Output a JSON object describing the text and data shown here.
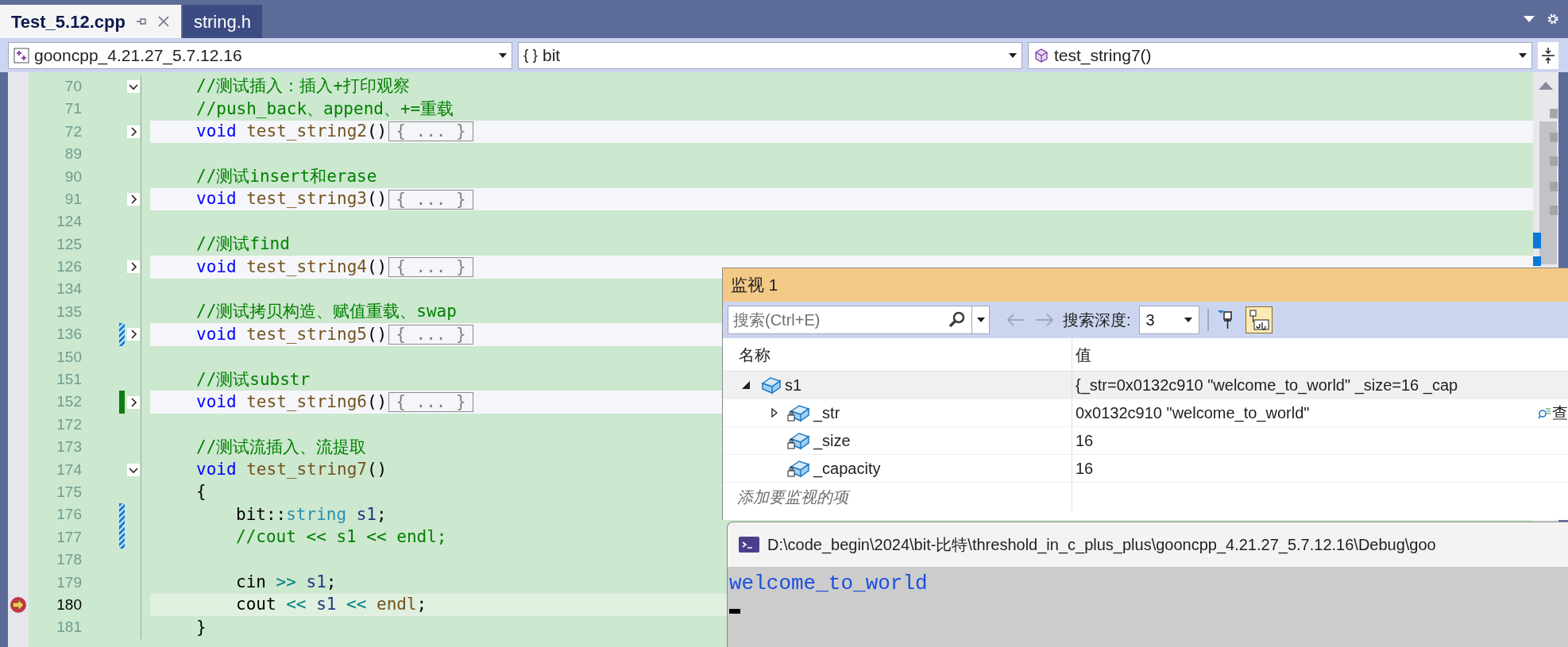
{
  "tabs": [
    {
      "label": "Test_5.12.cpp",
      "selected": true
    },
    {
      "label": "string.h",
      "selected": false
    }
  ],
  "navigation": [
    {
      "kind": "project",
      "text": "gooncpp_4.21.27_5.7.12.16"
    },
    {
      "kind": "scope",
      "glyph": "{ }",
      "text": "bit"
    },
    {
      "kind": "function",
      "text": "test_string7()"
    }
  ],
  "code": [
    {
      "number": "70",
      "collapsed": false,
      "current": false,
      "tokens": [
        {
          "kind": "comment",
          "text": "//测试插入：插入+打印观察"
        }
      ]
    },
    {
      "number": "71",
      "current": false,
      "tokens": [
        {
          "kind": "comment",
          "text": "//push_back、append、+=重载"
        }
      ]
    },
    {
      "number": "72",
      "collapsed": true,
      "collapsed_body": "{ ... }",
      "current": false,
      "tokens": [
        {
          "kind": "keyword",
          "text": "void"
        },
        {
          "kind": "function",
          "text": " test_string2"
        },
        {
          "kind": "punct",
          "text": "()"
        }
      ]
    },
    {
      "number": "89",
      "current": false
    },
    {
      "number": "90",
      "current": false,
      "tokens": [
        {
          "kind": "comment",
          "text": "//测试insert和erase"
        }
      ]
    },
    {
      "number": "91",
      "collapsed": true,
      "collapsed_body": "{ ... }",
      "current": false,
      "tokens": [
        {
          "kind": "keyword",
          "text": "void"
        },
        {
          "kind": "function",
          "text": " test_string3"
        },
        {
          "kind": "punct",
          "text": "()"
        }
      ]
    },
    {
      "number": "124",
      "current": false
    },
    {
      "number": "125",
      "current": false,
      "tokens": [
        {
          "kind": "comment",
          "text": "//测试find"
        }
      ]
    },
    {
      "number": "126",
      "collapsed": true,
      "collapsed_body": "{ ... }",
      "current": false,
      "tokens": [
        {
          "kind": "keyword",
          "text": "void"
        },
        {
          "kind": "function",
          "text": " test_string4"
        },
        {
          "kind": "punct",
          "text": "()"
        }
      ]
    },
    {
      "number": "134",
      "current": false
    },
    {
      "number": "135",
      "current": false,
      "tokens": [
        {
          "kind": "comment",
          "text": "//测试拷贝构造、赋值重载、swap"
        }
      ]
    },
    {
      "number": "136",
      "collapsed": true,
      "collapsed_body": "{ ... }",
      "change_saved": false,
      "current": false,
      "tokens": [
        {
          "kind": "keyword",
          "text": "void"
        },
        {
          "kind": "function",
          "text": " test_string5"
        },
        {
          "kind": "punct",
          "text": "()"
        }
      ]
    },
    {
      "number": "150",
      "current": false
    },
    {
      "number": "151",
      "current": false,
      "tokens": [
        {
          "kind": "comment",
          "text": "//测试substr"
        }
      ]
    },
    {
      "number": "152",
      "collapsed": true,
      "collapsed_body": "{ ... }",
      "change_saved": true,
      "current": false,
      "tokens": [
        {
          "kind": "keyword",
          "text": "void"
        },
        {
          "kind": "function",
          "text": " test_string6"
        },
        {
          "kind": "punct",
          "text": "()"
        }
      ]
    },
    {
      "number": "172",
      "current": false
    },
    {
      "number": "173",
      "current": false,
      "tokens": [
        {
          "kind": "comment",
          "text": "//测试流插入、流提取"
        }
      ]
    },
    {
      "number": "174",
      "collapsed": false,
      "current": false,
      "tokens": [
        {
          "kind": "keyword",
          "text": "void"
        },
        {
          "kind": "function",
          "text": " test_string7"
        },
        {
          "kind": "punct",
          "text": "()"
        }
      ]
    },
    {
      "number": "175",
      "current": false,
      "tokens": [
        {
          "kind": "punct",
          "text": "{"
        }
      ],
      "children": [
        {
          "number": "176",
          "change_saved": false,
          "current": false,
          "tokens": [
            {
              "kind": "punct",
              "text": "bit::"
            },
            {
              "kind": "type",
              "text": "string"
            },
            {
              "kind": "variable",
              "text": " s1"
            },
            {
              "kind": "punct",
              "text": ";"
            }
          ]
        },
        {
          "number": "177",
          "change_saved": false,
          "current": false,
          "tokens": [
            {
              "kind": "comment",
              "text": "//cout << s1 << endl;"
            }
          ]
        },
        {
          "number": "178",
          "current": false
        },
        {
          "number": "179",
          "current": false,
          "tokens": [
            {
              "kind": "punct",
              "text": "cin "
            },
            {
              "kind": "operator",
              "text": ">>"
            },
            {
              "kind": "variable",
              "text": " s1"
            },
            {
              "kind": "punct",
              "text": ";"
            }
          ]
        },
        {
          "number": "180",
          "current": true,
          "tokens": [
            {
              "kind": "punct",
              "text": "cout "
            },
            {
              "kind": "operator",
              "text": "<<"
            },
            {
              "kind": "variable",
              "text": " s1 "
            },
            {
              "kind": "operator",
              "text": "<<"
            },
            {
              "kind": "function",
              "text": " endl"
            },
            {
              "kind": "punct",
              "text": ";"
            }
          ]
        }
      ]
    },
    {
      "number": "181",
      "current": false,
      "tokens": [
        {
          "kind": "punct",
          "text": "}"
        }
      ]
    }
  ],
  "watch": {
    "title": "监视 1",
    "search": {
      "placeholder": "搜索(Ctrl+E)"
    },
    "depth_label": "搜索深度:",
    "depth": "3",
    "string_view_on": true,
    "columns": [
      "名称",
      "值"
    ],
    "rows": [
      {
        "name": "s1",
        "value": "{_str=0x0132c910 \"welcome_to_world\" _size=16 _cap",
        "expanded": true,
        "selected": true,
        "children": [
          {
            "name": "_str",
            "value": "0x0132c910 \"welcome_to_world\"",
            "expanded": false,
            "selected": false,
            "action": "查"
          },
          {
            "name": "_size",
            "value": "16",
            "selected": false
          },
          {
            "name": "_capacity",
            "value": "16",
            "selected": false
          }
        ]
      }
    ],
    "add_placeholder": "添加要监视的项"
  },
  "console": {
    "title": "D:\\code_begin\\2024\\bit-比特\\threshold_in_c_plus_plus\\gooncpp_4.21.27_5.7.12.16\\Debug\\goo",
    "output": "welcome_to_world"
  }
}
